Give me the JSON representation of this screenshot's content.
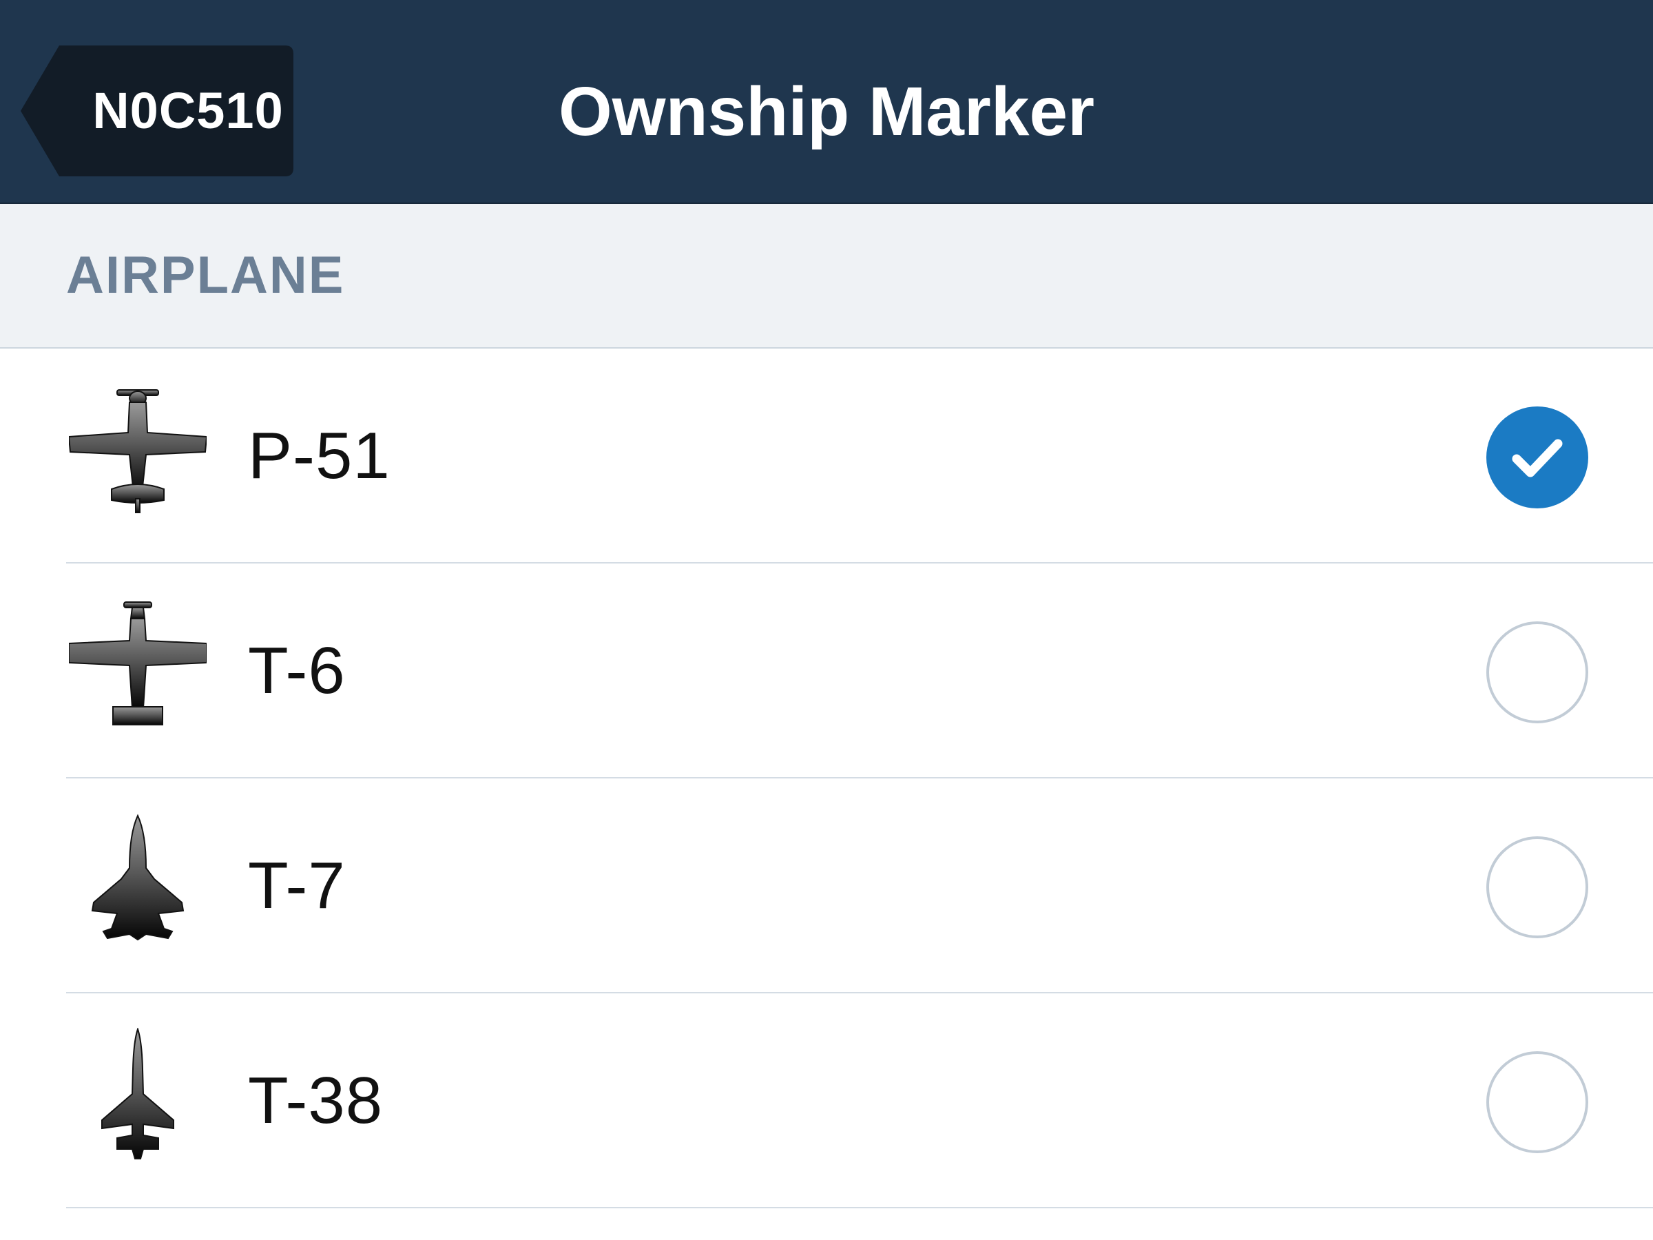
{
  "navbar": {
    "back_label": "N0C510",
    "title": "Ownship Marker",
    "background": "#1f364e"
  },
  "section": {
    "label": "AIRPLANE"
  },
  "items": [
    {
      "label": "P-51",
      "icon": "p51-airplane-icon",
      "selected": true
    },
    {
      "label": "T-6",
      "icon": "t6-airplane-icon",
      "selected": false
    },
    {
      "label": "T-7",
      "icon": "t7-jet-icon",
      "selected": false
    },
    {
      "label": "T-38",
      "icon": "t38-jet-icon",
      "selected": false
    }
  ],
  "colors": {
    "accent": "#1b7bc4",
    "section_text": "#6b7f95"
  }
}
